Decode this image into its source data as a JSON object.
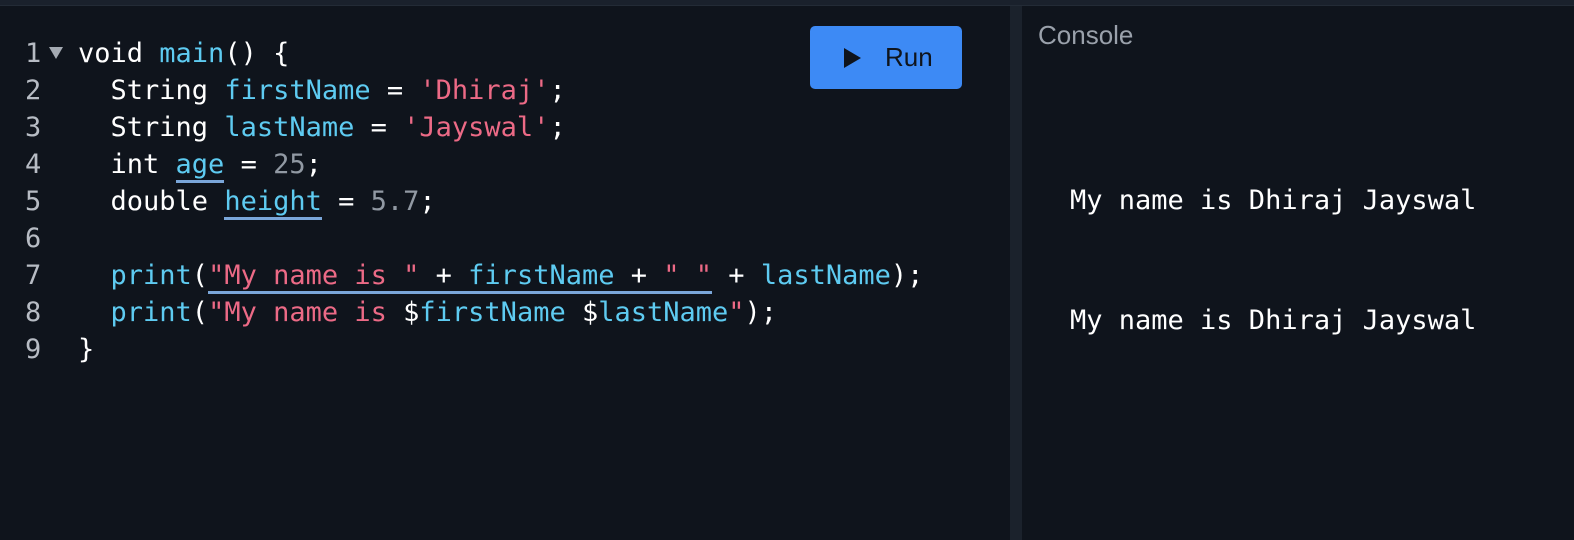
{
  "editor": {
    "run_label": "Run",
    "line_numbers": [
      "1",
      "2",
      "3",
      "4",
      "5",
      "6",
      "7",
      "8",
      "9"
    ],
    "lines": [
      [
        {
          "t": "void ",
          "c": "kw"
        },
        {
          "t": "main",
          "c": "id"
        },
        {
          "t": "() {",
          "c": "pl"
        }
      ],
      [
        {
          "t": "  String ",
          "c": "kw"
        },
        {
          "t": "firstName",
          "c": "id"
        },
        {
          "t": " = ",
          "c": "pl"
        },
        {
          "t": "'Dhiraj'",
          "c": "str"
        },
        {
          "t": ";",
          "c": "pl"
        }
      ],
      [
        {
          "t": "  String ",
          "c": "kw"
        },
        {
          "t": "lastName",
          "c": "id"
        },
        {
          "t": " = ",
          "c": "pl"
        },
        {
          "t": "'Jayswal'",
          "c": "str"
        },
        {
          "t": ";",
          "c": "pl"
        }
      ],
      [
        {
          "t": "  int ",
          "c": "kw"
        },
        {
          "t": "age",
          "c": "id ul"
        },
        {
          "t": " = ",
          "c": "pl"
        },
        {
          "t": "25",
          "c": "num"
        },
        {
          "t": ";",
          "c": "pl"
        }
      ],
      [
        {
          "t": "  double ",
          "c": "kw"
        },
        {
          "t": "height",
          "c": "id ul"
        },
        {
          "t": " = ",
          "c": "pl"
        },
        {
          "t": "5.7",
          "c": "num"
        },
        {
          "t": ";",
          "c": "pl"
        }
      ],
      [],
      [
        {
          "t": "  print",
          "c": "id"
        },
        {
          "t": "(",
          "c": "pl"
        },
        {
          "t": "\"My name is \"",
          "c": "str ul"
        },
        {
          "t": " + ",
          "c": "pl ul"
        },
        {
          "t": "firstName",
          "c": "id ul"
        },
        {
          "t": " + ",
          "c": "pl ul"
        },
        {
          "t": "\" \"",
          "c": "str ul"
        },
        {
          "t": " + ",
          "c": "pl"
        },
        {
          "t": "lastName",
          "c": "id"
        },
        {
          "t": ");",
          "c": "pl"
        }
      ],
      [
        {
          "t": "  print",
          "c": "id"
        },
        {
          "t": "(",
          "c": "pl"
        },
        {
          "t": "\"My name is ",
          "c": "str"
        },
        {
          "t": "$",
          "c": "pl"
        },
        {
          "t": "firstName",
          "c": "id"
        },
        {
          "t": " $",
          "c": "pl"
        },
        {
          "t": "lastName",
          "c": "id"
        },
        {
          "t": "\"",
          "c": "str"
        },
        {
          "t": ");",
          "c": "pl"
        }
      ],
      [
        {
          "t": "}",
          "c": "pl"
        }
      ]
    ]
  },
  "console": {
    "title": "Console",
    "output": [
      "My name is Dhiraj Jayswal",
      "My name is Dhiraj Jayswal"
    ]
  },
  "icons": {
    "run": "play-icon",
    "fold": "fold-arrow-icon"
  }
}
